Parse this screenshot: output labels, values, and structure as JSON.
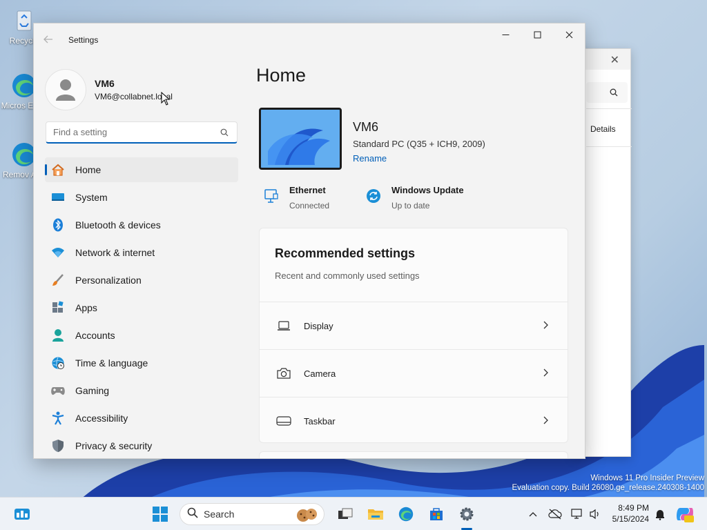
{
  "desktop": {
    "icons": [
      {
        "label": "Recycle"
      },
      {
        "label": "Micros Edge"
      },
      {
        "label": "Remov App"
      }
    ],
    "watermark_line1": "Windows 11 Pro Insider Preview",
    "watermark_line2": "Evaluation copy. Build 26080.ge_release.240308-1400"
  },
  "background_window": {
    "tab_label": "Details"
  },
  "window": {
    "title": "Settings"
  },
  "profile": {
    "name": "VM6",
    "email": "VM6@collabnet.local"
  },
  "search": {
    "placeholder": "Find a setting"
  },
  "nav": {
    "items": [
      {
        "label": "Home",
        "icon": "home-icon",
        "active": true
      },
      {
        "label": "System",
        "icon": "system-icon"
      },
      {
        "label": "Bluetooth & devices",
        "icon": "bluetooth-icon"
      },
      {
        "label": "Network & internet",
        "icon": "wifi-icon"
      },
      {
        "label": "Personalization",
        "icon": "brush-icon"
      },
      {
        "label": "Apps",
        "icon": "apps-icon"
      },
      {
        "label": "Accounts",
        "icon": "accounts-icon"
      },
      {
        "label": "Time & language",
        "icon": "globe-clock-icon"
      },
      {
        "label": "Gaming",
        "icon": "gamepad-icon"
      },
      {
        "label": "Accessibility",
        "icon": "accessibility-icon"
      },
      {
        "label": "Privacy & security",
        "icon": "shield-icon"
      }
    ]
  },
  "home": {
    "title": "Home",
    "device": {
      "name": "VM6",
      "spec": "Standard PC (Q35 + ICH9, 2009)",
      "rename": "Rename"
    },
    "ethernet": {
      "title": "Ethernet",
      "status": "Connected"
    },
    "update": {
      "title": "Windows Update",
      "status": "Up to date"
    },
    "recommended": {
      "title": "Recommended settings",
      "subtitle": "Recent and commonly used settings",
      "rows": [
        {
          "label": "Display",
          "icon": "laptop-icon"
        },
        {
          "label": "Camera",
          "icon": "camera-icon"
        },
        {
          "label": "Taskbar",
          "icon": "taskbar-icon"
        }
      ]
    }
  },
  "taskbar": {
    "search_label": "Search",
    "time": "8:49 PM",
    "date": "5/15/2024"
  },
  "colors": {
    "accent": "#005fb8"
  }
}
